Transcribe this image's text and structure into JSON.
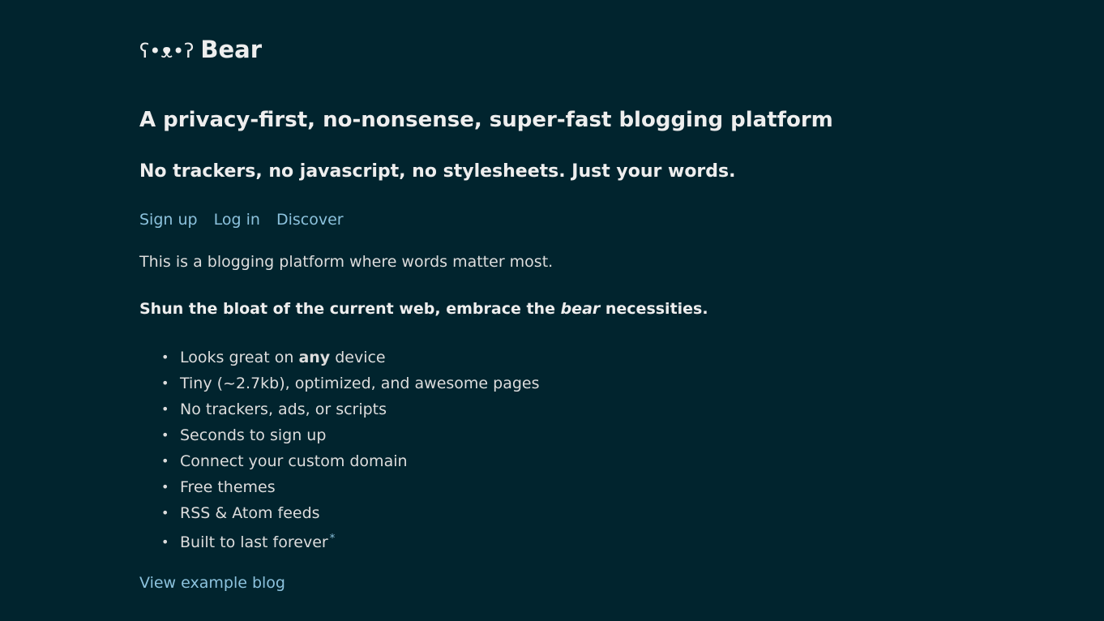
{
  "header": {
    "logo_face": "ʕ•ᴥ•ʔ",
    "title": "Bear"
  },
  "hero": {
    "headline": "A privacy-first, no-nonsense, super-fast blogging platform",
    "subheadline": "No trackers, no javascript, no stylesheets. Just your words."
  },
  "nav": {
    "items": [
      {
        "label": "Sign up"
      },
      {
        "label": "Log in"
      },
      {
        "label": "Discover"
      }
    ]
  },
  "intro": "This is a blogging platform where words matter most.",
  "tagline": {
    "before": "Shun the bloat of the current web, embrace the ",
    "emphasis": "bear",
    "after": " necessities."
  },
  "features": {
    "bullet": "•",
    "items": [
      {
        "before": "Looks great on ",
        "strong": "any",
        "after": " device"
      },
      {
        "text": "Tiny (~2.7kb), optimized, and awesome pages"
      },
      {
        "text": "No trackers, ads, or scripts"
      },
      {
        "text": "Seconds to sign up"
      },
      {
        "text": "Connect your custom domain"
      },
      {
        "text": "Free themes"
      },
      {
        "text": "RSS & Atom feeds"
      },
      {
        "text": "Built to last forever",
        "footnote_mark": "*"
      }
    ]
  },
  "example_link": "View example blog",
  "colors": {
    "background": "#01242e",
    "text": "#dddddd",
    "heading": "#eeeeee",
    "link": "#8cc2dd"
  }
}
